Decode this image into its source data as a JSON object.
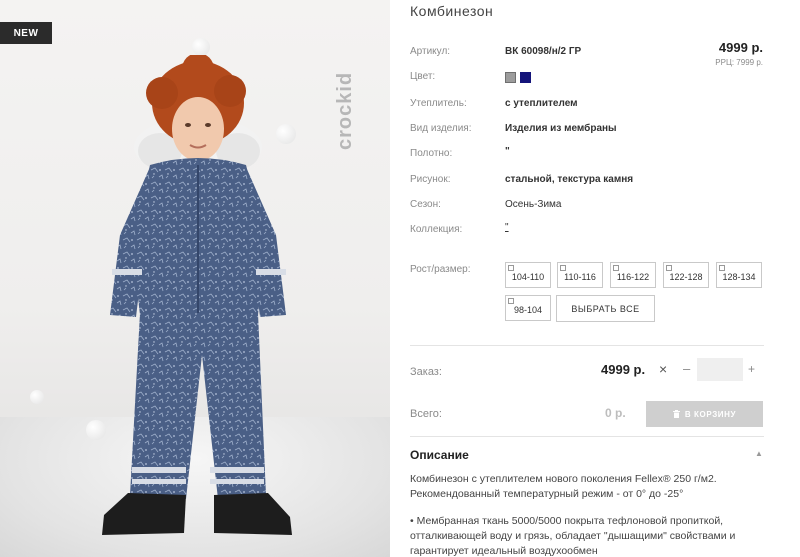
{
  "photo": {
    "badge": "NEW",
    "brand": "crockid"
  },
  "product": {
    "title": "Комбинезон",
    "price": "4999 р.",
    "rrp": "РРЦ: 7999 р.",
    "fields": {
      "article_label": "Артикул:",
      "article_value": "ВК 60098/н/2 ГР",
      "color_label": "Цвет:",
      "insulation_label": "Утеплитель:",
      "insulation_value": "с утеплителем",
      "type_label": "Вид изделия:",
      "type_value": "Изделия из мембраны",
      "fabric_label": "Полотно:",
      "fabric_value": "\"",
      "pattern_label": "Рисунок:",
      "pattern_value": "стальной, текстура камня",
      "season_label": "Сезон:",
      "season_value": "Осень-Зима",
      "collection_label": "Коллекция:",
      "collection_value": "\"",
      "size_label": "Рост/размер:"
    },
    "colors": [
      "#9c9c9c",
      "#14147a"
    ],
    "sizes": [
      "104-110",
      "110-116",
      "116-122",
      "122-128",
      "128-134",
      "98-104"
    ],
    "select_all": "ВЫБРАТЬ ВСЕ"
  },
  "order": {
    "order_label": "Заказ:",
    "order_price": "4999 р.",
    "times": "×",
    "minus": "–",
    "plus": "+",
    "total_label": "Всего:",
    "total_value": "0 р.",
    "cart_button": "В КОРЗИНУ"
  },
  "description": {
    "title": "Описание",
    "caret": "▲",
    "p1": "Комбинезон с утеплителем нового поколения Fellex® 250 г/м2. Рекомендованный температурный режим - от 0° до -25°",
    "p2": "• Мембранная ткань 5000/5000 покрыта тефлоновой пропиткой, отталкивающей воду и грязь, обладает \"дышащими\" свойствами и гарантирует идеальный воздухообмен"
  }
}
